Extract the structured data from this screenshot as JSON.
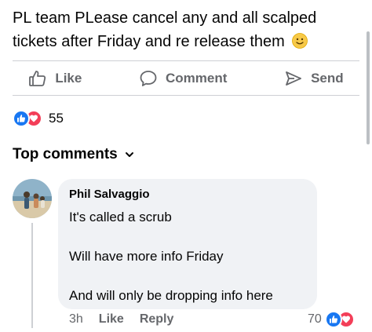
{
  "post": {
    "text": "PL team PLease cancel any and all scalped tickets after Friday and re release them",
    "emoji": "slightly-smiling-face-icon"
  },
  "actions": {
    "like_label": "Like",
    "comment_label": "Comment",
    "send_label": "Send"
  },
  "reactions": {
    "count": "55",
    "icons": [
      "like-reaction-icon",
      "love-reaction-icon"
    ]
  },
  "top_comments": {
    "label": "Top comments"
  },
  "comment": {
    "author": "Phil Salvaggio",
    "line1": "It's called a scrub",
    "line2": "Will have more info Friday",
    "line3": "And will only be dropping info here",
    "time": "3h",
    "like_label": "Like",
    "reply_label": "Reply",
    "reaction_count": "70"
  },
  "colors": {
    "accent": "#1877f2",
    "love": "#f33e58",
    "secondary_text": "#65676b",
    "bubble": "#f0f2f5"
  }
}
